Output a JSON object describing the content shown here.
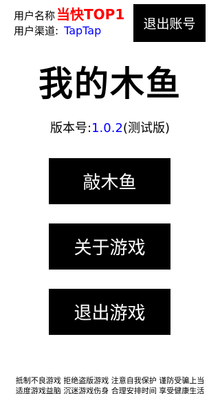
{
  "user": {
    "name_label": "用户名称",
    "name_value": "当快TOP1",
    "channel_label": "用户渠道:",
    "channel_value": "TapTap"
  },
  "header": {
    "logout_label": "退出账号"
  },
  "app": {
    "title": "我的木鱼",
    "version_prefix": "版本号:",
    "version_number": "1.0.2",
    "version_suffix": "(测试版)"
  },
  "menu": {
    "knock_label": "敲木鱼",
    "about_label": "关于游戏",
    "exit_label": "退出游戏"
  },
  "notice": {
    "line1": "抵制不良游戏 拒绝盗版游戏 注意自我保护 谨防受骗上当",
    "line2": "适度游戏益脑 沉迷游戏伤身 合理安排时间 享受健康生活"
  },
  "colors": {
    "name_accent": "#ff0000",
    "channel_accent": "#0000ff",
    "version_accent": "#0000ff",
    "button_bg": "#000000",
    "button_text": "#ffffff"
  }
}
